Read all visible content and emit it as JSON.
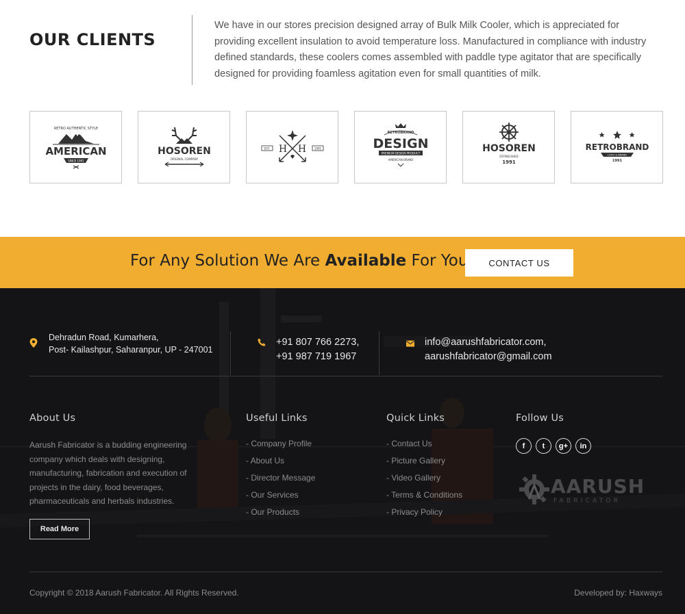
{
  "clients": {
    "title": "OUR CLIENTS",
    "description": "We have in our stores precision designed array of Bulk Milk Cooler, which is appreciated for providing excellent insulation to avoid temperature loss. Manufactured in compliance with industry defined standards, these coolers comes assembled with paddle type agitator that are specifically designed for providing foamless agitation even for small quantities of milk.",
    "logos": [
      {
        "main": "AMERICAN",
        "top": "RETRO AUTHENTIC STYLE",
        "sub": "SINCE 1991"
      },
      {
        "main": "HOSOREN",
        "sub": "ORIGINAL COMPANY"
      },
      {
        "main": "H H",
        "left": "EST.",
        "right": "1991"
      },
      {
        "main": "DESIGN",
        "top": "RETROBRAND",
        "sub": "PREMIUM DESIGN PRODUCT",
        "sub2": "AMERICAN BRAND"
      },
      {
        "main": "HOSOREN",
        "sub": "ESTABLISHED",
        "sub2": "1991"
      },
      {
        "main": "RETROBRAND",
        "sub": "LOGO & BRAND",
        "sub2": "1991"
      }
    ]
  },
  "cta": {
    "text_pre": "For Any Solution We Are ",
    "text_bold": "Available",
    "text_post": " For You",
    "button_label": "CONTACT US"
  },
  "footer": {
    "address_line1": "Dehradun Road, Kumarhera,",
    "address_line2": "Post- Kailashpur, Saharanpur, UP - 247001",
    "phone_line1": "+91 807 766 2273,",
    "phone_line2": "+91 987 719 1967",
    "email_line1": "info@aarushfabricator.com,",
    "email_line2": "aarushfabricator@gmail.com",
    "about": {
      "title": "About Us",
      "text": "Aarush Fabricator is a budding engineering company which deals with designing, manufacturing, fabrication and execution of projects in the dairy, food beverages, pharmaceuticals and herbals industries.",
      "read_more": "Read More"
    },
    "useful_links": {
      "title": "Useful Links",
      "items": [
        "- Company Profile",
        "- About Us",
        "- Director Message",
        "- Our Services",
        "- Our Products"
      ]
    },
    "quick_links": {
      "title": "Quick Links",
      "items": [
        "- Contact Us",
        "- Picture Gallery",
        "- Video Gallery",
        "- Terms & Conditions",
        "- Privacy Policy"
      ]
    },
    "follow": {
      "title": "Follow Us",
      "icons": [
        "facebook-icon",
        "twitter-icon",
        "google-plus-icon",
        "linkedin-icon"
      ],
      "glyphs": [
        "f",
        "t",
        "g+",
        "in"
      ]
    },
    "brand": {
      "name": "AARUSH",
      "tagline": "FABRICATOR"
    },
    "copyright": "Copyright © 2018 Aarush Fabricator. All Rights Reserved.",
    "developed_by": "Developed by: Haxways"
  },
  "colors": {
    "accent": "#f1ad2f",
    "footer_bg": "#141416",
    "icon": "#f1ad2f"
  }
}
